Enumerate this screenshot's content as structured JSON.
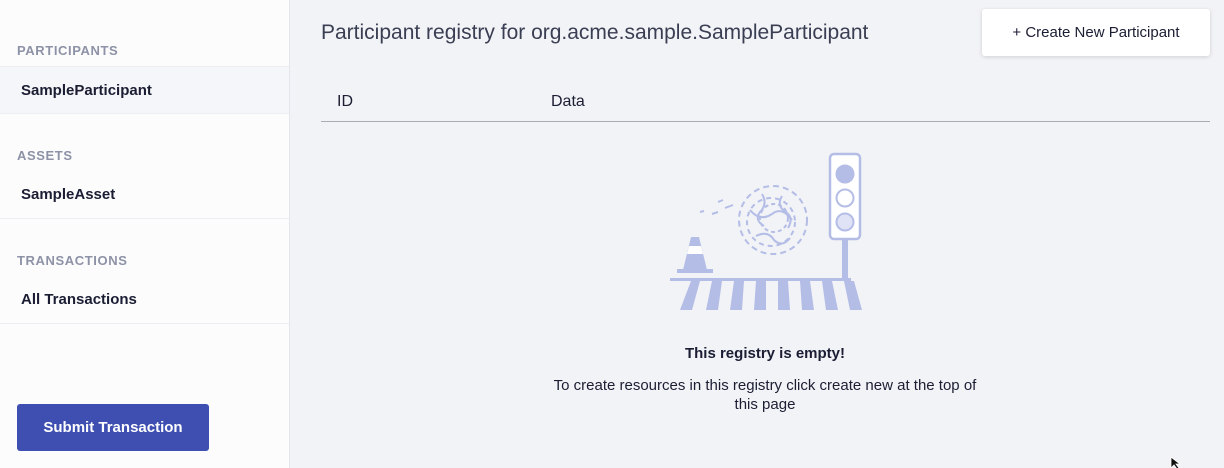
{
  "sidebar": {
    "sections": [
      {
        "title": "PARTICIPANTS",
        "items": [
          {
            "label": "SampleParticipant"
          }
        ]
      },
      {
        "title": "ASSETS",
        "items": [
          {
            "label": "SampleAsset"
          }
        ]
      },
      {
        "title": "TRANSACTIONS",
        "items": [
          {
            "label": "All Transactions"
          }
        ]
      }
    ],
    "submit_label": "Submit Transaction"
  },
  "main": {
    "title": "Participant registry for org.acme.sample.SampleParticipant",
    "create_label": "+ Create New Participant",
    "columns": [
      "ID",
      "Data"
    ],
    "empty_title": "This registry is empty!",
    "empty_text": "To create resources in this registry click create new at the top of this page"
  },
  "colors": {
    "accent": "#3e4fb1",
    "illustration": "#b4bde6"
  },
  "icons": {
    "illustration": "empty-registry-illustration",
    "cursor": "mouse-pointer-icon"
  }
}
